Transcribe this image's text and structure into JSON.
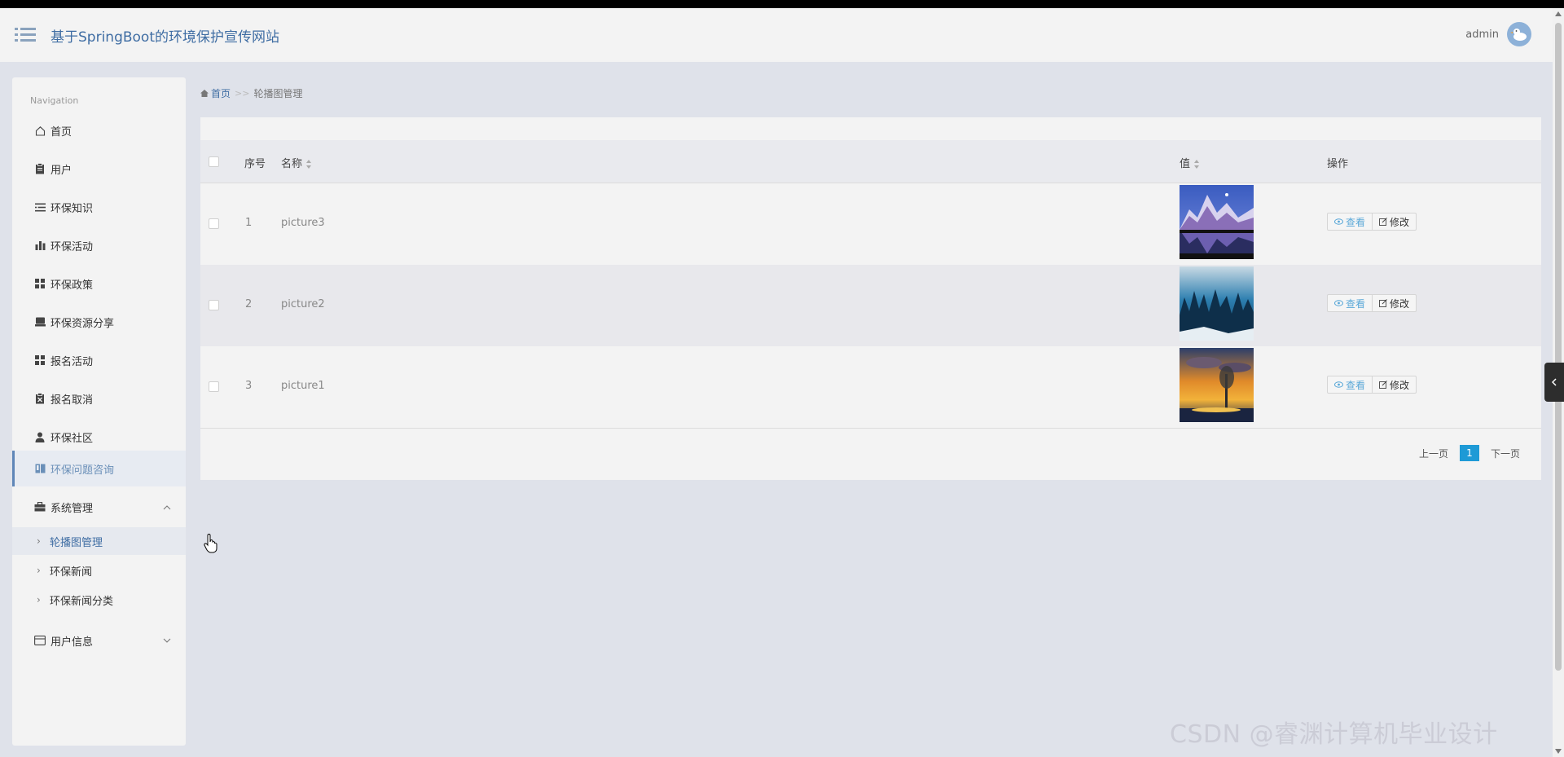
{
  "header": {
    "site_title": "基于SpringBoot的环境保护宣传网站",
    "user_name": "admin"
  },
  "sidebar": {
    "heading": "Navigation",
    "items": [
      {
        "label": "首页",
        "icon": "home-icon"
      },
      {
        "label": "用户",
        "icon": "clipboard-icon"
      },
      {
        "label": "环保知识",
        "icon": "list-icon"
      },
      {
        "label": "环保活动",
        "icon": "bar-chart-icon"
      },
      {
        "label": "环保政策",
        "icon": "grid-icon"
      },
      {
        "label": "环保资源分享",
        "icon": "inbox-icon"
      },
      {
        "label": "报名活动",
        "icon": "grid-icon"
      },
      {
        "label": "报名取消",
        "icon": "clipboard-x-icon"
      },
      {
        "label": "环保社区",
        "icon": "user-icon"
      },
      {
        "label": "环保问题咨询",
        "icon": "book-icon",
        "active": true
      },
      {
        "label": "系统管理",
        "icon": "briefcase-icon",
        "expanded": true
      },
      {
        "label": "用户信息",
        "icon": "card-icon",
        "expanded": false
      }
    ],
    "sub_items": [
      {
        "label": "轮播图管理",
        "active": true
      },
      {
        "label": "环保新闻"
      },
      {
        "label": "环保新闻分类"
      }
    ]
  },
  "breadcrumb": {
    "home": "首页",
    "separator": ">>",
    "current": "轮播图管理"
  },
  "table": {
    "columns": [
      "序号",
      "名称",
      "值",
      "操作"
    ],
    "rows": [
      {
        "index": "1",
        "name": "picture3",
        "image": "mountain-lake-thumbnail"
      },
      {
        "index": "2",
        "name": "picture2",
        "image": "snowy-forest-thumbnail"
      },
      {
        "index": "3",
        "name": "picture1",
        "image": "sunset-tree-thumbnail"
      }
    ],
    "view_label": "查看",
    "edit_label": "修改"
  },
  "pagination": {
    "prev": "上一页",
    "current": "1",
    "next": "下一页"
  },
  "watermark": "CSDN @睿渊计算机毕业设计",
  "colors": {
    "accent": "#3f6da3",
    "page_active": "#1e9ad6",
    "background": "#dfe2ea"
  }
}
